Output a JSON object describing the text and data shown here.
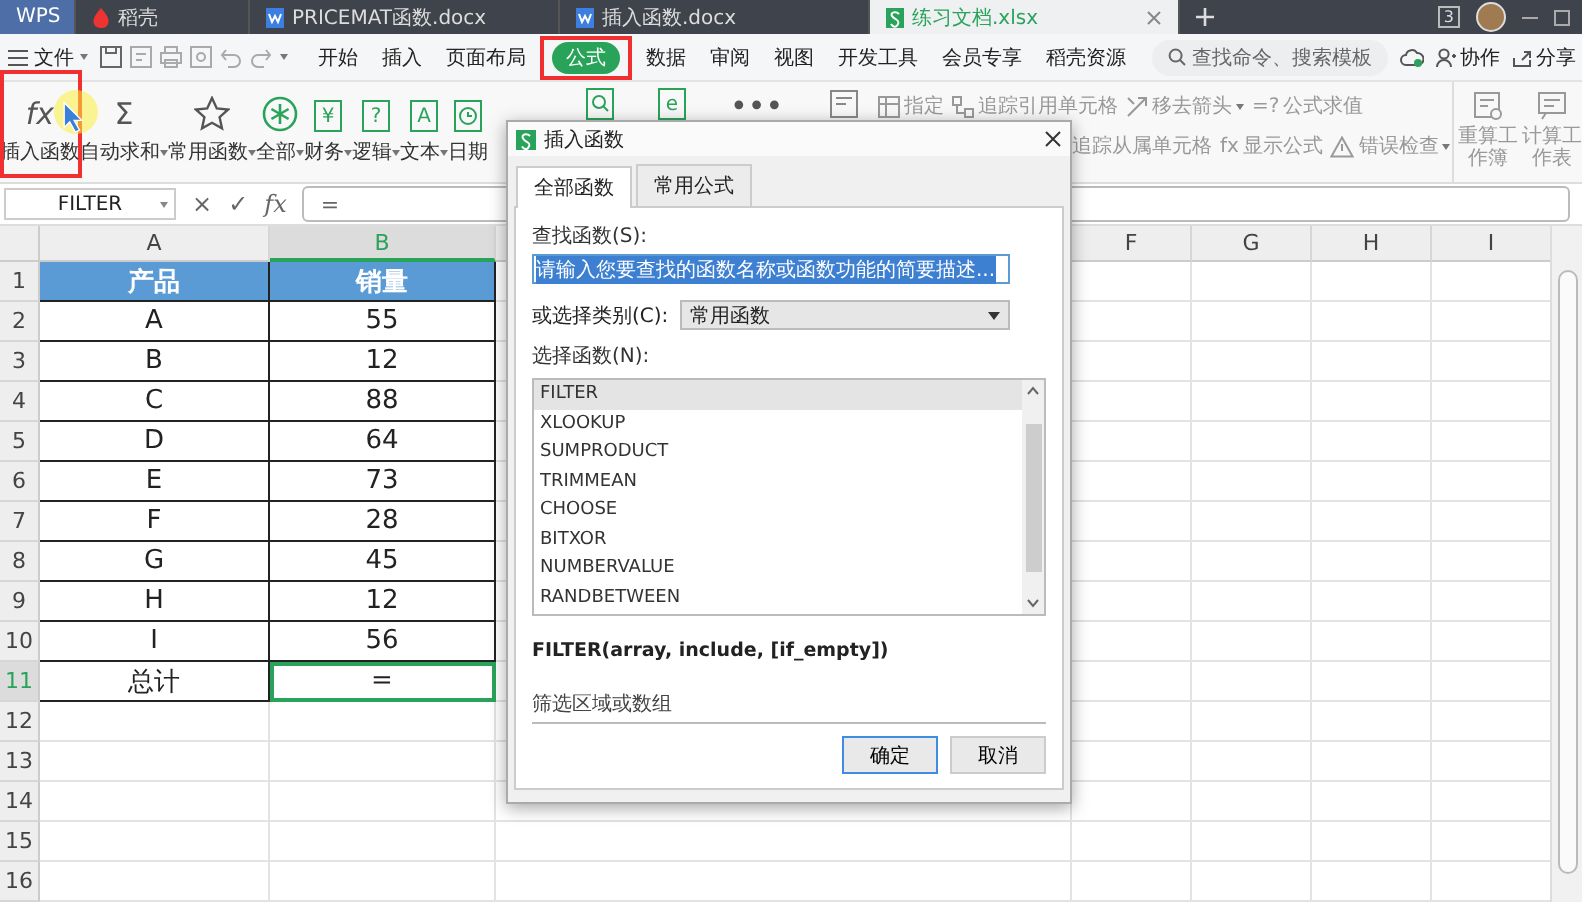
{
  "title_tabs": [
    {
      "label": "WPS",
      "kind": "home",
      "selected": false
    },
    {
      "label": "稻壳",
      "kind": "docer",
      "selected": false
    },
    {
      "label": "PRICEMAT函数.docx",
      "kind": "doc",
      "selected": false
    },
    {
      "label": "插入函数.docx",
      "kind": "doc",
      "selected": false
    },
    {
      "label": "练习文档.xlsx",
      "kind": "sheet",
      "selected": true
    }
  ],
  "window_count": "3",
  "menu": {
    "file": "文件",
    "tabs": [
      {
        "label": "开始",
        "selected": false
      },
      {
        "label": "插入",
        "selected": false
      },
      {
        "label": "页面布局",
        "selected": false
      },
      {
        "label": "公式",
        "selected": true
      },
      {
        "label": "数据",
        "selected": false
      },
      {
        "label": "审阅",
        "selected": false
      },
      {
        "label": "视图",
        "selected": false
      },
      {
        "label": "开发工具",
        "selected": false
      },
      {
        "label": "会员专享",
        "selected": false
      },
      {
        "label": "稻壳资源",
        "selected": false
      }
    ],
    "search": {
      "placeholder": "查找命令、搜索模板"
    },
    "actions": [
      {
        "label": "协作",
        "kind": "collab"
      },
      {
        "label": "分享",
        "kind": "share"
      }
    ]
  },
  "ribbon": {
    "buttons": [
      {
        "label": "插入函数",
        "kind": "glyph",
        "glyph": "fx",
        "dropdown": false
      },
      {
        "label": "自动求和",
        "kind": "glyph",
        "glyph": "Σ",
        "dropdown": true
      },
      {
        "label": "常用函数",
        "kind": "star",
        "dropdown": true
      },
      {
        "label": "全部",
        "kind": "asterisk",
        "dropdown": true
      },
      {
        "label": "财务",
        "kind": "box",
        "glyph": "¥",
        "dropdown": true
      },
      {
        "label": "逻辑",
        "kind": "box",
        "glyph": "?",
        "dropdown": true
      },
      {
        "label": "文本",
        "kind": "box",
        "glyph": "A",
        "dropdown": true
      },
      {
        "label": "日期",
        "kind": "clock",
        "dropdown": false
      }
    ],
    "icon_buttons": [
      {
        "kind": "lookup"
      },
      {
        "kind": "box",
        "glyph": "e"
      },
      {
        "kind": "glyph",
        "glyph": "•••"
      },
      {
        "kind": "names"
      }
    ],
    "tools_top": [
      {
        "label": "指定",
        "kind": "define",
        "dropdown": false
      },
      {
        "label": "追踪引用单元格",
        "kind": "trace",
        "dropdown": false
      },
      {
        "label": "移去箭头",
        "kind": "remove",
        "dropdown": true
      },
      {
        "label": "公式求值",
        "kind": "glyph",
        "glyph": "=?",
        "dropdown": false
      }
    ],
    "tools_bottom": [
      {
        "label": "追踪从属单元格",
        "kind": "none",
        "dropdown": false
      },
      {
        "label": "显示公式",
        "kind": "glyph",
        "glyph": "fx",
        "dropdown": false
      },
      {
        "label": "错误检查",
        "kind": "warning",
        "dropdown": true
      }
    ],
    "calc": [
      "重算工作簿",
      "计算工作表"
    ]
  },
  "formula_bar": {
    "name_box": "FILTER",
    "buttons": [
      "×",
      "✓",
      "fx"
    ],
    "value": "="
  },
  "sheet": {
    "columns": [
      {
        "label": "A",
        "selected": false
      },
      {
        "label": "B",
        "selected": true
      },
      {
        "label": "F",
        "selected": false
      },
      {
        "label": "G",
        "selected": false
      },
      {
        "label": "H",
        "selected": false
      },
      {
        "label": "I",
        "selected": false
      }
    ],
    "row_numbers": [
      {
        "label": "1",
        "selected": false
      },
      {
        "label": "2",
        "selected": false
      },
      {
        "label": "3",
        "selected": false
      },
      {
        "label": "4",
        "selected": false
      },
      {
        "label": "5",
        "selected": false
      },
      {
        "label": "6",
        "selected": false
      },
      {
        "label": "7",
        "selected": false
      },
      {
        "label": "8",
        "selected": false
      },
      {
        "label": "9",
        "selected": false
      },
      {
        "label": "10",
        "selected": false
      },
      {
        "label": "11",
        "selected": true
      },
      {
        "label": "12",
        "selected": false
      },
      {
        "label": "13",
        "selected": false
      },
      {
        "label": "14",
        "selected": false
      },
      {
        "label": "15",
        "selected": false
      },
      {
        "label": "16",
        "selected": false
      }
    ],
    "rows": [
      {
        "kind": "header",
        "cells": [
          {
            "text": "产品",
            "selected": false
          },
          {
            "text": "销量",
            "selected": false
          }
        ]
      },
      {
        "kind": "data",
        "cells": [
          {
            "text": "A",
            "selected": false
          },
          {
            "text": "55",
            "selected": false
          }
        ]
      },
      {
        "kind": "data",
        "cells": [
          {
            "text": "B",
            "selected": false
          },
          {
            "text": "12",
            "selected": false
          }
        ]
      },
      {
        "kind": "data",
        "cells": [
          {
            "text": "C",
            "selected": false
          },
          {
            "text": "88",
            "selected": false
          }
        ]
      },
      {
        "kind": "data",
        "cells": [
          {
            "text": "D",
            "selected": false
          },
          {
            "text": "64",
            "selected": false
          }
        ]
      },
      {
        "kind": "data",
        "cells": [
          {
            "text": "E",
            "selected": false
          },
          {
            "text": "73",
            "selected": false
          }
        ]
      },
      {
        "kind": "data",
        "cells": [
          {
            "text": "F",
            "selected": false
          },
          {
            "text": "28",
            "selected": false
          }
        ]
      },
      {
        "kind": "data",
        "cells": [
          {
            "text": "G",
            "selected": false
          },
          {
            "text": "45",
            "selected": false
          }
        ]
      },
      {
        "kind": "data",
        "cells": [
          {
            "text": "H",
            "selected": false
          },
          {
            "text": "12",
            "selected": false
          }
        ]
      },
      {
        "kind": "data",
        "cells": [
          {
            "text": "I",
            "selected": false
          },
          {
            "text": "56",
            "selected": false
          }
        ]
      },
      {
        "kind": "data",
        "cells": [
          {
            "text": "总计",
            "selected": false
          },
          {
            "text": "=",
            "selected": true
          }
        ]
      }
    ]
  },
  "dialog": {
    "title": "插入函数",
    "tabs": [
      {
        "label": "全部函数",
        "selected": true
      },
      {
        "label": "常用公式",
        "selected": false
      }
    ],
    "search_label": "查找函数(S):",
    "search_value": "请输入您要查找的函数名称或函数功能的简要描述...",
    "search_value_selected": true,
    "category_label": "或选择类别(C):",
    "category": "常用函数",
    "list_label": "选择函数(N):",
    "functions": [
      {
        "name": "FILTER",
        "selected": true
      },
      {
        "name": "XLOOKUP",
        "selected": false
      },
      {
        "name": "SUMPRODUCT",
        "selected": false
      },
      {
        "name": "TRIMMEAN",
        "selected": false
      },
      {
        "name": "CHOOSE",
        "selected": false
      },
      {
        "name": "BITXOR",
        "selected": false
      },
      {
        "name": "NUMBERVALUE",
        "selected": false
      },
      {
        "name": "RANDBETWEEN",
        "selected": false
      }
    ],
    "signature": "FILTER(array, include, [if_empty])",
    "description": "筛选区域或数组",
    "buttons": [
      {
        "label": "确定",
        "kind": "default"
      },
      {
        "label": "取消",
        "kind": "normal"
      }
    ]
  }
}
